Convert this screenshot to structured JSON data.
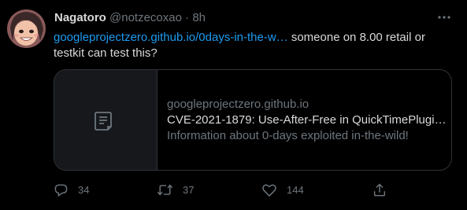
{
  "tweet": {
    "author_name": "Nagatoro",
    "handle": "@notzecoxao",
    "dot": "·",
    "time": "8h",
    "link_text": "googleprojectzero.github.io/0days-in-the-w…",
    "body_text": " someone on 8.00 retail or testkit can test this?"
  },
  "card": {
    "domain": "googleprojectzero.github.io",
    "title": "CVE-2021-1879: Use-After-Free in QuickTimePlugi…",
    "description": "Information about 0-days exploited in-the-wild!"
  },
  "actions": {
    "reply_count": "34",
    "retweet_count": "37",
    "like_count": "144"
  },
  "colors": {
    "background": "#000000",
    "text": "#d9d9d9",
    "secondary": "#6e767d",
    "link": "#1d9bf0",
    "border": "#2f3336"
  },
  "icons": [
    "more-icon",
    "document-icon",
    "reply-icon",
    "retweet-icon",
    "like-icon",
    "share-icon"
  ]
}
